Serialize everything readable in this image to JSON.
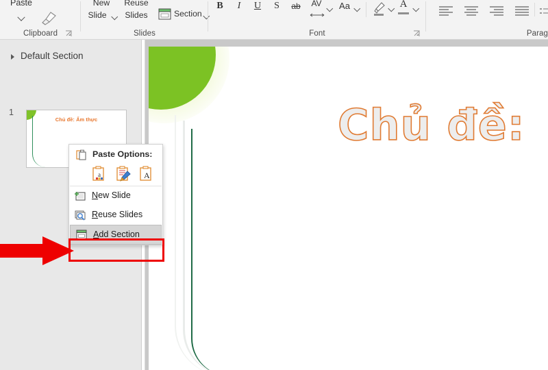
{
  "ribbon": {
    "groups": [
      {
        "label": "Clipboard"
      },
      {
        "label": "Slides"
      },
      {
        "label": "Font"
      },
      {
        "label": "Parag"
      }
    ],
    "clipboard": {
      "paste_label": "Paste",
      "format_painter_icon": "paintbrush-icon",
      "dialog_launcher_icon": "dialog-launcher-icon"
    },
    "slides": {
      "new_slide_label": "New\nSlide",
      "new_slide_line1": "New",
      "new_slide_line2": "Slide",
      "reuse_slides_line1": "Reuse",
      "reuse_slides_line2": "Slides",
      "section_label": "Section",
      "section_icon": "section-icon"
    },
    "font": {
      "bold": "B",
      "italic": "I",
      "underline": "U",
      "shadow": "S",
      "strikethrough": "ab",
      "character_spacing": "AV",
      "change_case": "Aa",
      "text_highlight_icon": "highlighter-icon",
      "font_color": "A",
      "dialog_launcher_icon": "dialog-launcher-icon"
    },
    "paragraph": {
      "align_left_icon": "align-left-icon",
      "align_center_icon": "align-center-icon",
      "align_right_icon": "align-right-icon",
      "justify_icon": "justify-icon",
      "list_icon": "bullet-list-icon"
    }
  },
  "slide_panel": {
    "section_name": "Default Section",
    "slide_number": "1",
    "thumbnail_title": "Chủ đề: Ẩm thực"
  },
  "slide": {
    "title": "Chủ đề:"
  },
  "context_menu": {
    "paste_options_label": "Paste Options:",
    "paste_option_icons": [
      {
        "name": "paste-use-destination-theme-icon",
        "glyph": "a"
      },
      {
        "name": "paste-picture-icon",
        "glyph": "brush"
      },
      {
        "name": "paste-keep-text-only-icon",
        "glyph": "A"
      }
    ],
    "items": [
      {
        "name": "new-slide",
        "accel": "N",
        "rest": "ew Slide",
        "icon": "new-slide-icon",
        "highlighted": false
      },
      {
        "name": "reuse-slides",
        "accel": "R",
        "rest": "euse Slides",
        "icon": "reuse-slides-icon",
        "highlighted": false
      },
      {
        "name": "add-section",
        "accel": "A",
        "rest": "dd Section",
        "icon": "add-section-icon",
        "highlighted": true
      }
    ]
  },
  "annotations": {
    "arrow_color": "#ee0000",
    "highlight_box_color": "#ee0000",
    "arrow_target": "add-section"
  },
  "colors": {
    "ribbon_bg": "#f3f3f3",
    "panel_bg": "#e8e8e8",
    "canvas_bg": "#c9c9c9",
    "title_stroke": "#e07b33",
    "title_fill": "#ededed",
    "deco_green": "#7cc224",
    "stem_green": "#1f6b46",
    "thumb_title_color": "#e8762c",
    "menu_highlight": "#d6d6d6"
  }
}
